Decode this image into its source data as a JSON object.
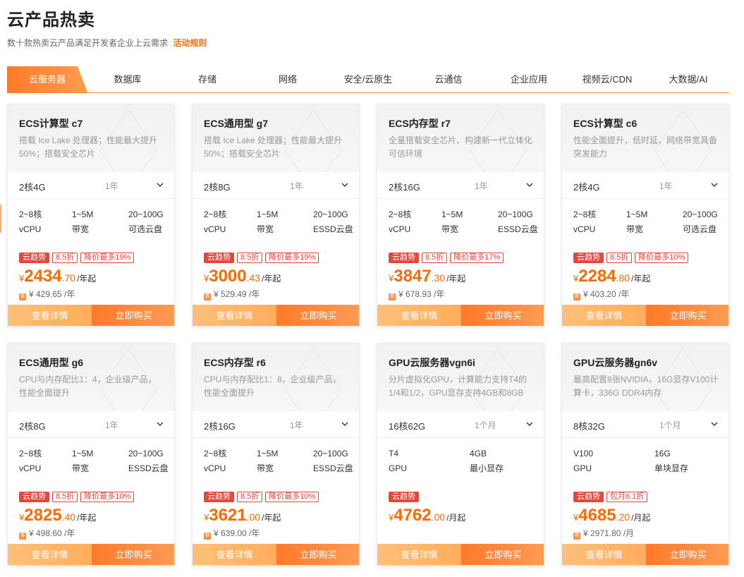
{
  "header": {
    "title": "云产品热卖",
    "subtitle": "数十款热卖云产品满足开发者企业上云需求",
    "rules_link": "活动规则"
  },
  "tabs": [
    {
      "label": "云服务器",
      "active": true
    },
    {
      "label": "数据库"
    },
    {
      "label": "存储"
    },
    {
      "label": "网络"
    },
    {
      "label": "安全/云原生"
    },
    {
      "label": "云通信"
    },
    {
      "label": "企业应用"
    },
    {
      "label": "视频云/CDN"
    },
    {
      "label": "大数据/AI"
    }
  ],
  "icons": {
    "chevron": "chevron-down-icon",
    "coupon": "coupon-icon"
  },
  "colors": {
    "accent": "#ff6a00",
    "tag_red": "#e5473b"
  },
  "cards": [
    {
      "name": "ECS计算型 c7",
      "desc": "搭载 Ice Lake 处理器；性能最大提升50%；搭载安全芯片",
      "config": "2核4G",
      "period": "1年",
      "specs": [
        [
          "2~8核",
          "vCPU"
        ],
        [
          "1~5M",
          "带宽"
        ],
        [
          "20~100G",
          "可选云盘"
        ]
      ],
      "tags": [
        "云趋势",
        "8.5折",
        "降价最多19%"
      ],
      "price_currency": "¥",
      "price_int": "2434",
      "price_dec": ".70",
      "price_unit": "/年起",
      "orig_price": "¥ 429.65 /年",
      "detail_label": "查看详情",
      "buy_label": "立即购买"
    },
    {
      "name": "ECS通用型 g7",
      "desc": "搭载 Ice Lake 处理器；性能最大提升50%；搭载安全芯片",
      "config": "2核8G",
      "period": "1年",
      "specs": [
        [
          "2~8核",
          "vCPU"
        ],
        [
          "1~5M",
          "带宽"
        ],
        [
          "20~100G",
          "ESSD云盘"
        ]
      ],
      "tags": [
        "云趋势",
        "8.5折",
        "降价最多19%"
      ],
      "price_currency": "¥",
      "price_int": "3000",
      "price_dec": ".43",
      "price_unit": "/年起",
      "orig_price": "¥ 529.49 /年",
      "detail_label": "查看详情",
      "buy_label": "立即购买"
    },
    {
      "name": "ECS内存型 r7",
      "desc": "全量搭载安全芯片、构建新一代立体化可信环境",
      "config": "2核16G",
      "period": "1年",
      "specs": [
        [
          "2~8核",
          "vCPU"
        ],
        [
          "1~5M",
          "带宽"
        ],
        [
          "20~100G",
          "ESSD云盘"
        ]
      ],
      "tags": [
        "云趋势",
        "8.5折",
        "降价最多17%"
      ],
      "price_currency": "¥",
      "price_int": "3847",
      "price_dec": ".30",
      "price_unit": "/年起",
      "orig_price": "¥ 678.93 /年",
      "detail_label": "查看详情",
      "buy_label": "立即购买"
    },
    {
      "name": "ECS计算型 c6",
      "desc": "性能全面提升，低时延，网络带宽具备突发能力",
      "config": "2核4G",
      "period": "1年",
      "specs": [
        [
          "2~8核",
          "vCPU"
        ],
        [
          "1~5M",
          "带宽"
        ],
        [
          "20~100G",
          "可选云盘"
        ]
      ],
      "tags": [
        "云趋势",
        "8.5折",
        "降价最多10%"
      ],
      "price_currency": "¥",
      "price_int": "2284",
      "price_dec": ".80",
      "price_unit": "/年起",
      "orig_price": "¥ 403.20 /年",
      "detail_label": "查看详情",
      "buy_label": "立即购买"
    },
    {
      "name": "ECS通用型 g6",
      "desc": "CPU与内存配比1：4，企业级产品，性能全面提升",
      "config": "2核8G",
      "period": "1年",
      "specs": [
        [
          "2~8核",
          "vCPU"
        ],
        [
          "1~5M",
          "带宽"
        ],
        [
          "20~100G",
          "ESSD云盘"
        ]
      ],
      "tags": [
        "云趋势",
        "8.5折",
        "降价最多10%"
      ],
      "price_currency": "¥",
      "price_int": "2825",
      "price_dec": ".40",
      "price_unit": "/年起",
      "orig_price": "¥ 498.60 /年",
      "detail_label": "查看详情",
      "buy_label": "立即购买"
    },
    {
      "name": "ECS内存型 r6",
      "desc": "CPU与内存配比1：8，企业级产品，性能全面提升",
      "config": "2核16G",
      "period": "1年",
      "specs": [
        [
          "2~8核",
          "vCPU"
        ],
        [
          "1~5M",
          "带宽"
        ],
        [
          "20~100G",
          "ESSD云盘"
        ]
      ],
      "tags": [
        "云趋势",
        "8.5折",
        "降价最多10%"
      ],
      "price_currency": "¥",
      "price_int": "3621",
      "price_dec": ".00",
      "price_unit": "/年起",
      "orig_price": "¥ 639.00 /年",
      "detail_label": "查看详情",
      "buy_label": "立即购买"
    },
    {
      "name": "GPU云服务器vgn6i",
      "desc": "分片虚拟化GPU，计算能力支持T4的1/4和1/2，GPU显存支持4GB和8GB",
      "config": "16核62G",
      "period": "1个月",
      "specs": [
        [
          "T4",
          "GPU"
        ],
        [
          "4GB",
          "最小显存"
        ]
      ],
      "tags": [
        "云趋势"
      ],
      "price_currency": "¥",
      "price_int": "4762",
      "price_dec": ".00",
      "price_unit": "/月起",
      "orig_price": "",
      "detail_label": "查看详情",
      "buy_label": "立即购买"
    },
    {
      "name": "GPU云服务器gn6v",
      "desc": "最高配置8张NVIDIA，16G显存V100计算卡，336G DDR4内存",
      "config": "8核32G",
      "period": "1个月",
      "specs": [
        [
          "V100",
          "GPU"
        ],
        [
          "16G",
          "单块显存"
        ]
      ],
      "tags": [
        "云趋势",
        "包月6.1折"
      ],
      "price_currency": "¥",
      "price_int": "4685",
      "price_dec": ".20",
      "price_unit": "/月起",
      "orig_price": "¥ 2971.80 /月",
      "detail_label": "查看详情",
      "buy_label": "立即购买"
    }
  ]
}
